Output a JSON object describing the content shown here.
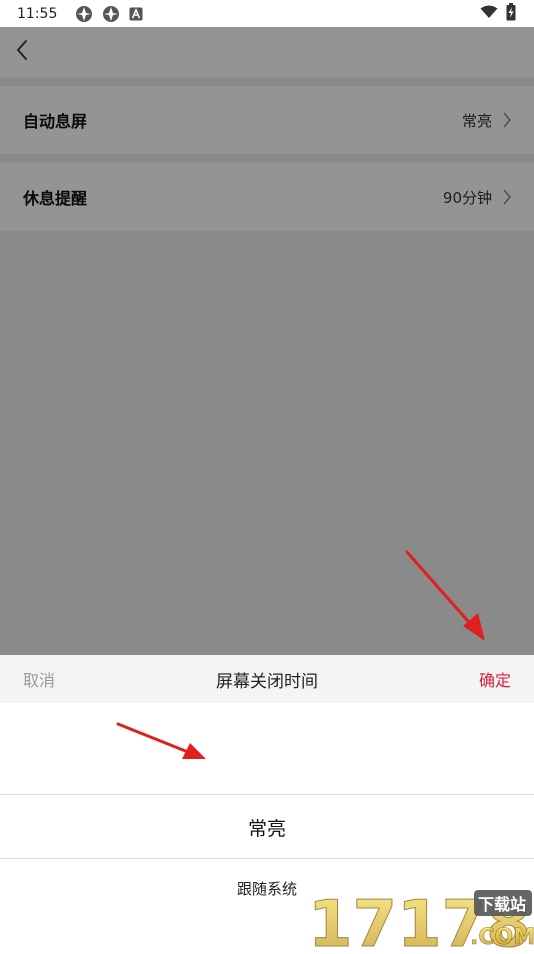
{
  "status_bar": {
    "time": "11:55",
    "left_icons": [
      "app-notification-icon",
      "app-notification-icon",
      "a-letter-icon"
    ],
    "right_icons": [
      "wifi-icon",
      "battery-charging-icon"
    ]
  },
  "nav": {
    "back_icon": "chevron-left-icon"
  },
  "settings": {
    "rows": [
      {
        "label": "自动息屏",
        "value": "常亮"
      },
      {
        "label": "休息提醒",
        "value": "90分钟"
      }
    ]
  },
  "sheet": {
    "cancel_label": "取消",
    "title": "屏幕关闭时间",
    "confirm_label": "确定",
    "options": [
      "常亮",
      "跟随系统"
    ],
    "selected_index": 0
  },
  "watermark": {
    "text": "17178",
    "badge": "下载站",
    "suffix": ".COM"
  },
  "colors": {
    "accent": "#d81e3c",
    "cancel_text": "#9a9a9a",
    "arrow": "#e0201c",
    "overlay": "rgba(0,0,0,0.42)"
  }
}
